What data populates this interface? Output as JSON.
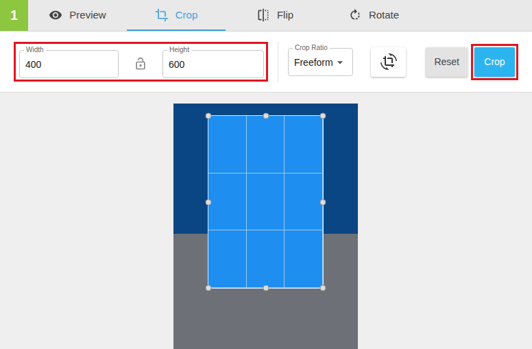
{
  "step": "1",
  "tabs": [
    {
      "label": "Preview",
      "selected": false
    },
    {
      "label": "Crop",
      "selected": true
    },
    {
      "label": "Flip",
      "selected": false
    },
    {
      "label": "Rotate",
      "selected": false
    }
  ],
  "toolbar": {
    "dimensions_highlighted": true,
    "width": {
      "label": "Width",
      "value": "400"
    },
    "aspect_locked": false,
    "height": {
      "label": "Height",
      "value": "600"
    },
    "crop_ratio": {
      "label": "Crop Ratio",
      "value": "Freeform"
    },
    "buttons": [
      {
        "label": "Reset",
        "kind": "secondary",
        "highlighted": false
      },
      {
        "label": "Crop",
        "kind": "primary",
        "highlighted": true
      }
    ]
  }
}
